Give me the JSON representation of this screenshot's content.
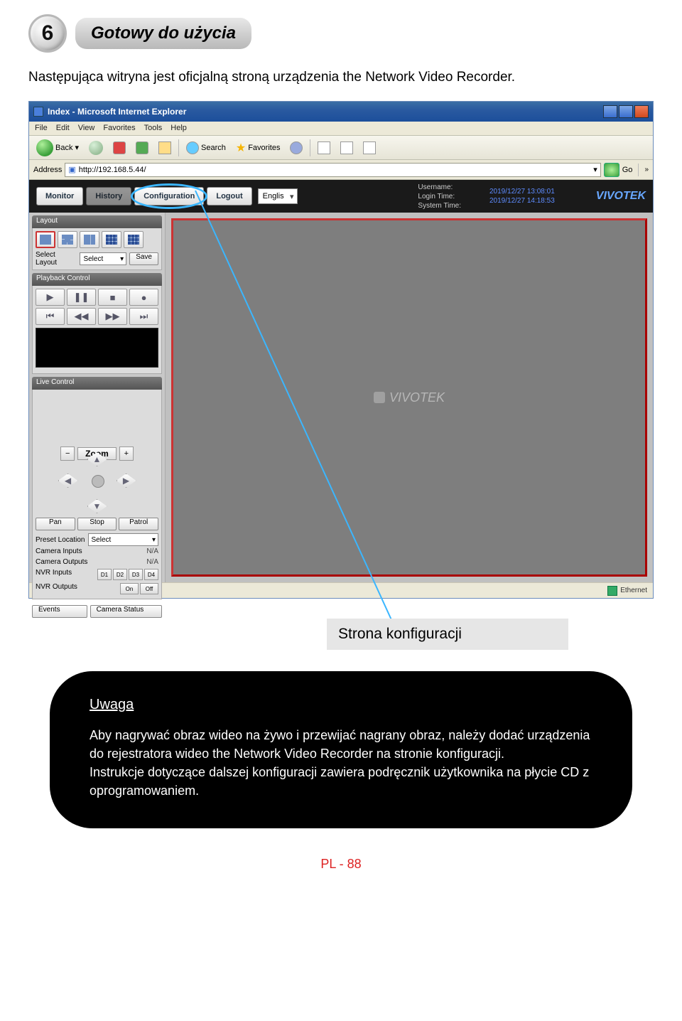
{
  "step": {
    "number": "6",
    "title": "Gotowy do użycia"
  },
  "intro": "Następująca witryna jest oficjalną stroną urządzenia the Network Video Recorder.",
  "ie": {
    "title": "Index - Microsoft Internet Explorer",
    "menu": [
      "File",
      "Edit",
      "View",
      "Favorites",
      "Tools",
      "Help"
    ],
    "toolbar": {
      "back": "Back",
      "search": "Search",
      "favorites": "Favorites"
    },
    "address_label": "Address",
    "address_value": "http://192.168.5.44/",
    "go": "Go",
    "status": "Ethernet"
  },
  "app": {
    "tabs": {
      "monitor": "Monitor",
      "history": "History",
      "config": "Configuration",
      "logout": "Logout"
    },
    "language": "Englis",
    "info_labels": {
      "user": "Username:",
      "login": "Login Time:",
      "system": "System Time:"
    },
    "info_values": {
      "user": "",
      "login": "2019/12/27 13:08:01",
      "system": "2019/12/27 14:18:53"
    },
    "brand": "VIVOTEK",
    "panels": {
      "layout": {
        "title": "Layout",
        "select_label": "Select Layout",
        "select_value": "Select",
        "save": "Save"
      },
      "playback": {
        "title": "Playback Control"
      },
      "live": {
        "title": "Live Control"
      },
      "zoom": "Zoom",
      "pan": "Pan",
      "stop": "Stop",
      "patrol": "Patrol",
      "preset": {
        "label": "Preset Location",
        "value": "Select"
      },
      "camera_inputs": {
        "label": "Camera Inputs",
        "value": "N/A"
      },
      "camera_outputs": {
        "label": "Camera Outputs",
        "value": "N/A"
      },
      "nvr_inputs": {
        "label": "NVR Inputs",
        "io": [
          "D1",
          "D2",
          "D3",
          "D4"
        ]
      },
      "nvr_outputs": {
        "label": "NVR Outputs",
        "on": "On",
        "off": "Off"
      },
      "events": "Events",
      "camera_status": "Camera Status"
    },
    "video_brand": "VIVOTEK"
  },
  "callout": "Strona konfiguracji",
  "note": {
    "title": "Uwaga",
    "body": "Aby nagrywać obraz wideo na żywo i przewijać nagrany obraz, należy dodać urządzenia do rejestratora wideo the Network Video Recorder na stronie konfiguracji.\nInstrukcje dotyczące dalszej konfiguracji zawiera podręcznik użytkownika na płycie CD z oprogramowaniem."
  },
  "page_number": "PL - 88"
}
